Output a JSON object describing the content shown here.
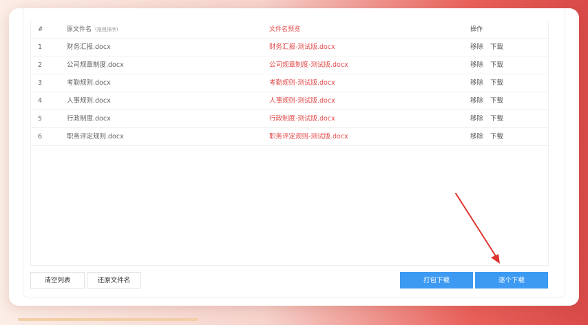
{
  "table": {
    "headers": {
      "num": "#",
      "original": "原文件名",
      "original_hint": "(拖拽排序)",
      "preview": "文件名预览",
      "actions": "操作"
    },
    "rows": [
      {
        "num": "1",
        "original": "财务汇报.docx",
        "preview": "财务汇报-测试版.docx",
        "remove": "移除",
        "download": "下载"
      },
      {
        "num": "2",
        "original": "公司规章制度.docx",
        "preview": "公司规章制度-测试版.docx",
        "remove": "移除",
        "download": "下载"
      },
      {
        "num": "3",
        "original": "考勤规则.docx",
        "preview": "考勤规则-测试版.docx",
        "remove": "移除",
        "download": "下载"
      },
      {
        "num": "4",
        "original": "人事规则.docx",
        "preview": "人事规则-测试版.docx",
        "remove": "移除",
        "download": "下载"
      },
      {
        "num": "5",
        "original": "行政制度.docx",
        "preview": "行政制度-测试版.docx",
        "remove": "移除",
        "download": "下载"
      },
      {
        "num": "6",
        "original": "职务评定规则.docx",
        "preview": "职务评定规则-测试版.docx",
        "remove": "移除",
        "download": "下载"
      }
    ]
  },
  "buttons": {
    "clear": "清空列表",
    "restore": "还原文件名",
    "pack_download": "打包下载",
    "each_download": "逐个下载"
  },
  "colors": {
    "accent_blue": "#3d9af2",
    "preview_red": "#e14b4b",
    "annotation_arrow": "#e0332e"
  }
}
